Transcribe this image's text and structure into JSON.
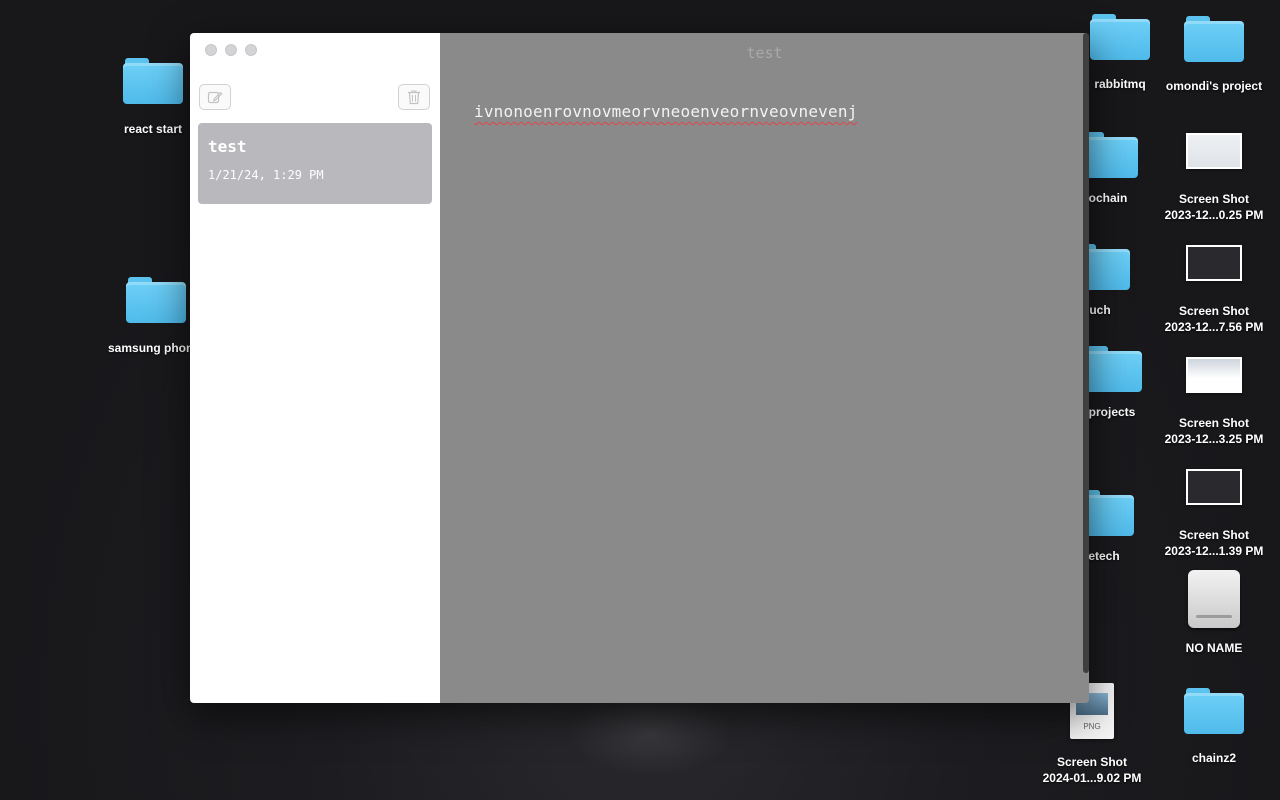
{
  "desktop": {
    "items": [
      {
        "label": "react start",
        "kind": "folder"
      },
      {
        "label": "samsung phon",
        "kind": "folder"
      },
      {
        "label": "rabbitmq",
        "kind": "folder"
      },
      {
        "label": "omondi's project",
        "kind": "folder"
      },
      {
        "label": "ochain",
        "kind": "folder"
      },
      {
        "label": "Screen Shot\n2023-12...0.25 PM",
        "line1": "Screen Shot",
        "line2": "2023-12...0.25 PM",
        "kind": "screenshot"
      },
      {
        "label": "uch",
        "kind": "folder"
      },
      {
        "label": "Screen Shot 2023-12...7.56 PM",
        "line1": "Screen Shot",
        "line2": "2023-12...7.56 PM",
        "kind": "screenshot"
      },
      {
        "label": "projects",
        "kind": "folder"
      },
      {
        "label": "Screen Shot 2023-12...3.25 PM",
        "line1": "Screen Shot",
        "line2": "2023-12...3.25 PM",
        "kind": "screenshot"
      },
      {
        "label": "etech",
        "kind": "folder"
      },
      {
        "label": "Screen Shot 2023-12...1.39 PM",
        "line1": "Screen Shot",
        "line2": "2023-12...1.39 PM",
        "kind": "screenshot"
      },
      {
        "label": "NO NAME",
        "kind": "drive"
      },
      {
        "label": "Screen Shot 2024-01...9.02 PM",
        "line1": "Screen Shot",
        "line2": "2024-01...9.02 PM",
        "kind": "png",
        "ext": "PNG"
      },
      {
        "label": "chainz2",
        "kind": "folder"
      }
    ]
  },
  "app": {
    "sidebar": {
      "new_note_icon": "compose-icon",
      "delete_icon": "trash-icon",
      "notes": [
        {
          "title": "test",
          "date": "1/21/24, 1:29 PM"
        }
      ]
    },
    "editor": {
      "title": "test",
      "body": "ivnonoenrovnovmeorvneoenveornveovnevenj"
    }
  },
  "colors": {
    "folder": "#5cc3ef",
    "editor_bg": "#8a8a8a",
    "selected_note": "#b9b8bd",
    "spellcheck": "#e0454a"
  }
}
